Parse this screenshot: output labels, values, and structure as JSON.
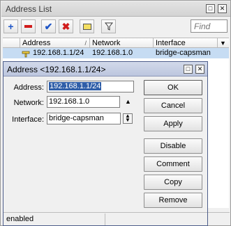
{
  "window": {
    "title": "Address List",
    "find_placeholder": "Find"
  },
  "table": {
    "columns": [
      "Address",
      "Network",
      "Interface"
    ],
    "rows": [
      {
        "address": "192.168.1.1/24",
        "network": "192.168.1.0",
        "interface": "bridge-capsman"
      }
    ]
  },
  "dialog": {
    "title": "Address <192.168.1.1/24>",
    "fields": {
      "address_label": "Address:",
      "address_value": "192.168.1.1/24",
      "network_label": "Network:",
      "network_value": "192.168.1.0",
      "interface_label": "Interface:",
      "interface_value": "bridge-capsman"
    },
    "buttons": {
      "ok": "OK",
      "cancel": "Cancel",
      "apply": "Apply",
      "disable": "Disable",
      "comment": "Comment",
      "copy": "Copy",
      "remove": "Remove"
    },
    "status": "enabled"
  },
  "colors": {
    "add": "#1f56c7",
    "remove": "#d11c1c",
    "enable": "#1f56c7",
    "disable": "#d11c1c",
    "selection": "#c6dcf3"
  }
}
